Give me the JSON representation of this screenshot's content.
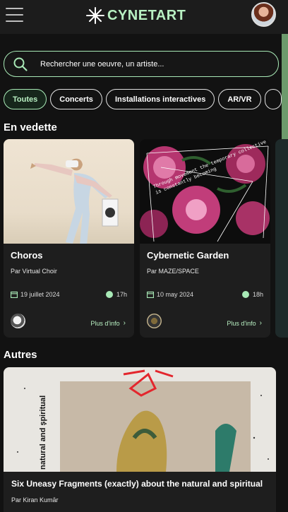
{
  "app": {
    "brand": "CYNETART"
  },
  "search": {
    "placeholder": "Rechercher une oeuvre, un artiste..."
  },
  "filters": [
    "Toutes",
    "Concerts",
    "Installations interactives",
    "AR/VR"
  ],
  "sections": {
    "featured": "En vedette",
    "others": "Autres"
  },
  "featured": [
    {
      "title": "Choros",
      "author": "Par Virtual Choir",
      "date": "19 juillet 2024",
      "time": "17h",
      "more": "Plus d'info"
    },
    {
      "title": "Cybernetic Garden",
      "author": "Par MAZE/SPACE",
      "date": "10 may 2024",
      "time": "18h",
      "more": "Plus d'info",
      "image_text": "Through movement the temporary collective is constantly becoming"
    }
  ],
  "others": [
    {
      "title": "Six Uneasy Fragments (exactly) about the natural and spiritual",
      "author": "Par Kiran Kumār",
      "image_text": "natural and spiritual"
    }
  ],
  "colors": {
    "accent": "#a8e9b6",
    "background": "#121212",
    "card": "#1e1e1e",
    "header": "#1c1c1c"
  }
}
